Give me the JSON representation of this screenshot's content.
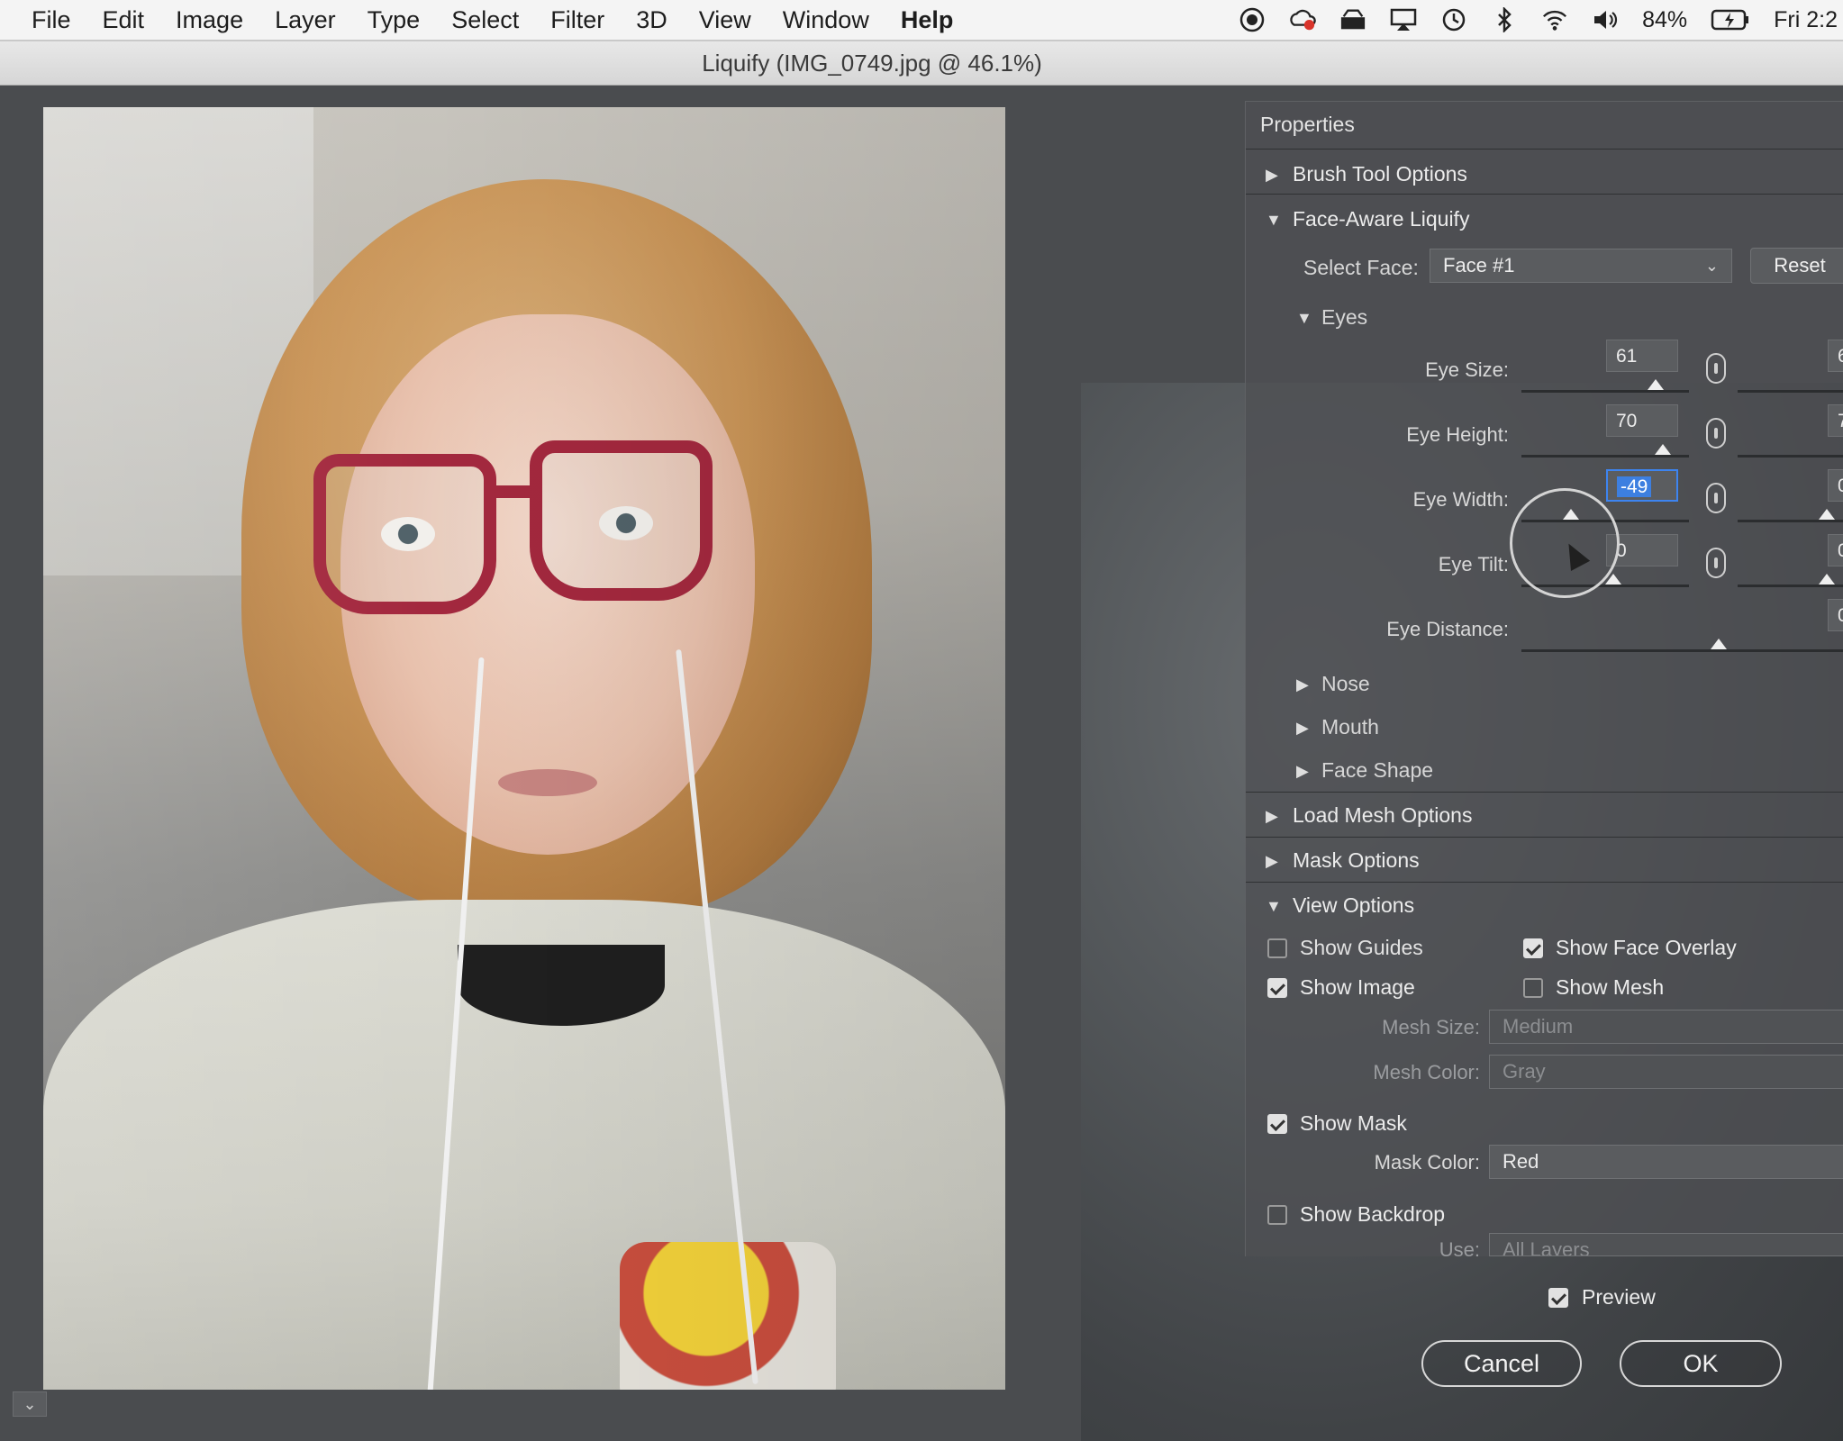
{
  "menubar": {
    "items": [
      "File",
      "Edit",
      "Image",
      "Layer",
      "Type",
      "Select",
      "Filter",
      "3D",
      "View",
      "Window",
      "Help"
    ],
    "battery": "84%",
    "clock": "Fri 2:2"
  },
  "window": {
    "title": "Liquify (IMG_0749.jpg @ 46.1%)"
  },
  "panel": {
    "title": "Properties",
    "sections": {
      "brush_tool_options": "Brush Tool Options",
      "face_aware_liquify": "Face-Aware Liquify",
      "load_mesh_options": "Load Mesh Options",
      "mask_options": "Mask Options",
      "view_options": "View Options"
    },
    "select_face": {
      "label": "Select Face:",
      "value": "Face #1",
      "reset": "Reset"
    },
    "eyes": {
      "label": "Eyes",
      "size": {
        "label": "Eye Size:",
        "left": "61",
        "right": "6"
      },
      "height": {
        "label": "Eye Height:",
        "left": "70",
        "right": "7"
      },
      "width": {
        "label": "Eye Width:",
        "left": "-49",
        "right": "0"
      },
      "tilt": {
        "label": "Eye Tilt:",
        "left": "0",
        "right": "0"
      },
      "distance": {
        "label": "Eye Distance:",
        "right": "0"
      }
    },
    "subsections": {
      "nose": "Nose",
      "mouth": "Mouth",
      "face_shape": "Face Shape"
    },
    "view_options": {
      "show_guides": "Show Guides",
      "show_face_overlay": "Show Face Overlay",
      "show_image": "Show Image",
      "show_mesh": "Show Mesh",
      "mesh_size_label": "Mesh Size:",
      "mesh_size_value": "Medium",
      "mesh_color_label": "Mesh Color:",
      "mesh_color_value": "Gray",
      "show_mask": "Show Mask",
      "mask_color_label": "Mask Color:",
      "mask_color_value": "Red",
      "show_backdrop": "Show Backdrop",
      "use_label": "Use:",
      "use_value": "All Layers"
    },
    "preview": "Preview",
    "cancel": "Cancel",
    "ok": "OK"
  }
}
